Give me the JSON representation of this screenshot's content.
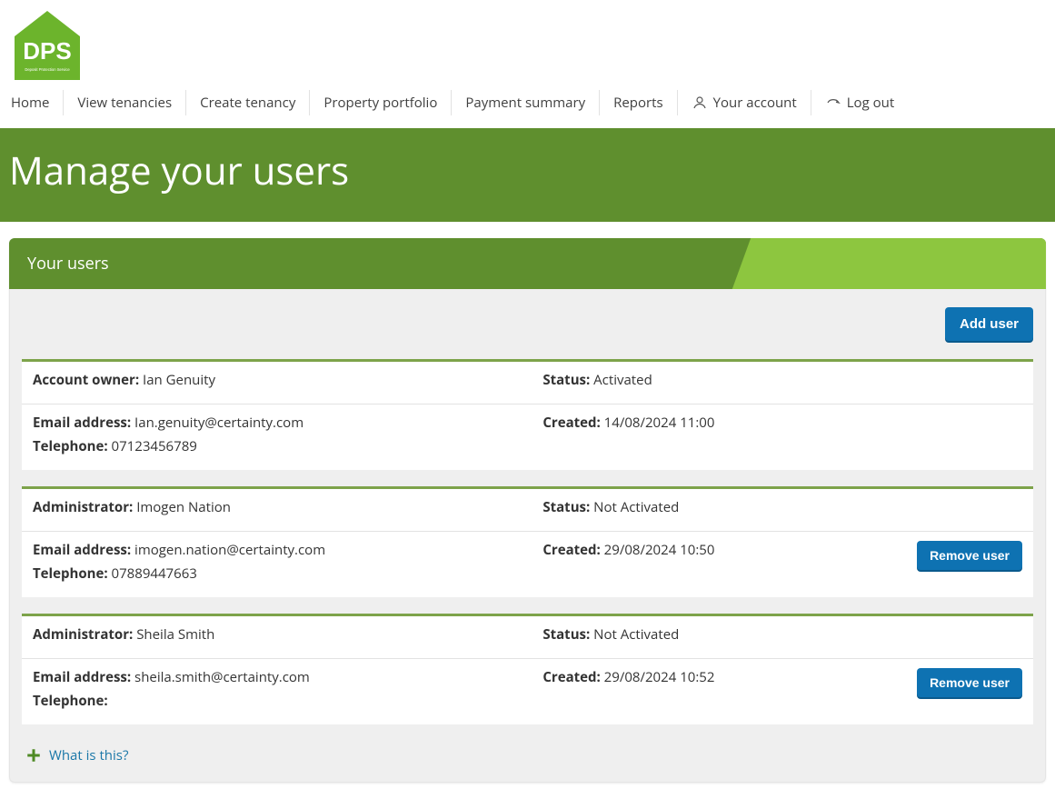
{
  "brand": {
    "abbr": "DPS",
    "full": "Deposit Protection Service"
  },
  "nav": {
    "home": "Home",
    "view_tenancies": "View tenancies",
    "create_tenancy": "Create tenancy",
    "property_portfolio": "Property portfolio",
    "payment_summary": "Payment summary",
    "reports": "Reports",
    "your_account": "Your account",
    "log_out": "Log out"
  },
  "page_title": "Manage your users",
  "panel_title": "Your users",
  "buttons": {
    "add_user": "Add user",
    "remove_user": "Remove user"
  },
  "labels": {
    "account_owner": "Account owner:",
    "administrator": "Administrator:",
    "status": "Status:",
    "email": "Email address:",
    "telephone": "Telephone:",
    "created": "Created:"
  },
  "help_link": "What is this?",
  "users": [
    {
      "role_label_key": "account_owner",
      "name": "Ian Genuity",
      "status": "Activated",
      "email": "Ian.genuity@certainty.com",
      "telephone": "07123456789",
      "created": "14/08/2024 11:00",
      "removable": false
    },
    {
      "role_label_key": "administrator",
      "name": "Imogen Nation",
      "status": "Not Activated",
      "email": "imogen.nation@certainty.com",
      "telephone": "07889447663",
      "created": "29/08/2024 10:50",
      "removable": true
    },
    {
      "role_label_key": "administrator",
      "name": "Sheila Smith",
      "status": "Not Activated",
      "email": "sheila.smith@certainty.com",
      "telephone": "<not given>",
      "created": "29/08/2024 10:52",
      "removable": true
    }
  ]
}
